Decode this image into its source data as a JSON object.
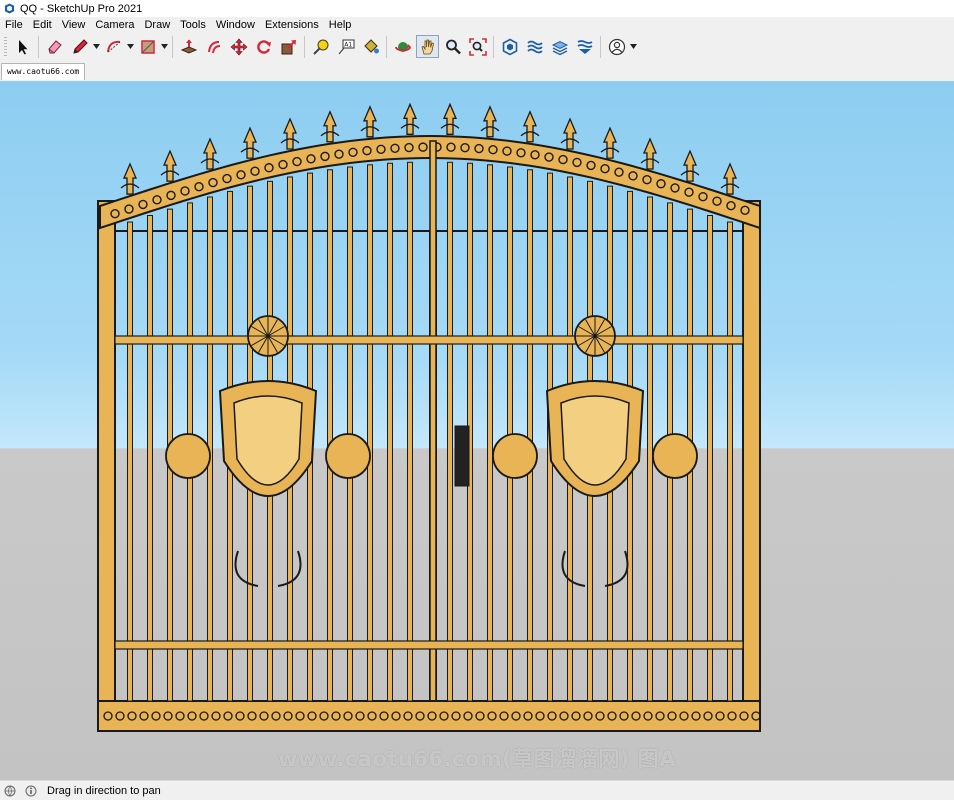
{
  "window": {
    "title": "QQ - SketchUp Pro 2021"
  },
  "menu": [
    "File",
    "Edit",
    "View",
    "Camera",
    "Draw",
    "Tools",
    "Window",
    "Extensions",
    "Help"
  ],
  "toolbar": [
    {
      "name": "select-tool",
      "icon": "arrow-cursor-icon"
    },
    {
      "name": "eraser-tool",
      "icon": "eraser-icon"
    },
    {
      "name": "line-tool",
      "icon": "pencil-icon",
      "dropdown": true
    },
    {
      "name": "arc-tool",
      "icon": "arc-icon",
      "dropdown": true
    },
    {
      "name": "shapes-tool",
      "icon": "rectangle-icon",
      "dropdown": true
    },
    {
      "name": "push-pull-tool",
      "icon": "push-pull-icon"
    },
    {
      "name": "offset-tool",
      "icon": "offset-icon"
    },
    {
      "name": "move-tool",
      "icon": "move-icon"
    },
    {
      "name": "rotate-tool",
      "icon": "rotate-icon"
    },
    {
      "name": "scale-tool",
      "icon": "scale-icon"
    },
    {
      "name": "tape-measure-tool",
      "icon": "tape-measure-icon"
    },
    {
      "name": "text-tool",
      "icon": "text-label-icon"
    },
    {
      "name": "paint-bucket-tool",
      "icon": "paint-bucket-icon"
    },
    {
      "name": "orbit-tool",
      "icon": "orbit-icon"
    },
    {
      "name": "pan-tool",
      "icon": "hand-icon",
      "active": true
    },
    {
      "name": "zoom-tool",
      "icon": "magnifier-icon"
    },
    {
      "name": "zoom-extents-tool",
      "icon": "zoom-extents-icon"
    },
    {
      "name": "warehouse-button",
      "icon": "warehouse-icon"
    },
    {
      "name": "extension-warehouse-button",
      "icon": "extension-warehouse-icon"
    },
    {
      "name": "share-model-button",
      "icon": "share-model-icon"
    },
    {
      "name": "layout-button",
      "icon": "layout-icon"
    },
    {
      "name": "account-button",
      "icon": "user-account-icon",
      "dropdown": true
    }
  ],
  "scene_tab": {
    "label": "www.caotu66.com"
  },
  "viewport": {
    "sky_color": "#9fd6f6",
    "ground_color": "#c6c6c6",
    "gate_color": "#e8b455",
    "outline_color": "#1a1a1a"
  },
  "watermark": {
    "text": "www.caotu66.com(草图溜溜网) 图A"
  },
  "status": {
    "text": "Drag in direction to pan",
    "icons": [
      "help-globe-icon",
      "info-icon"
    ]
  },
  "colors": {
    "accent": "#0078d7",
    "toolbar_bg": "#f0f0f0"
  }
}
